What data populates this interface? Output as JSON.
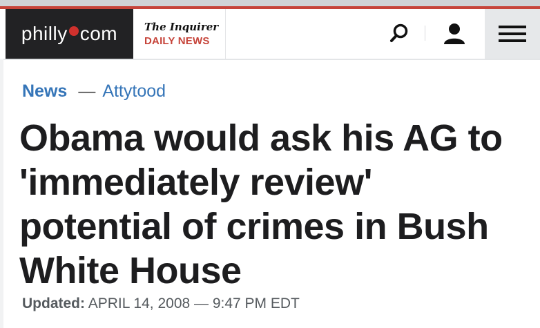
{
  "header": {
    "logo_left": "philly",
    "logo_right": "com",
    "partner_line1": "The Inquirer",
    "partner_line2": "DAILY NEWS",
    "icons": [
      "search-icon",
      "user-icon",
      "hamburger-menu-icon"
    ]
  },
  "breadcrumb": {
    "section": "News",
    "separator": "—",
    "column": "Attytood"
  },
  "article": {
    "headline": "Obama would ask his AG to 'immediately review' potential of crimes in Bush White House",
    "updated_label": "Updated:",
    "updated_value": "APRIL 14, 2008 — 9:47 PM EDT"
  },
  "colors": {
    "accent_red": "#c6443a",
    "link_blue": "#3575b8",
    "logo_bg": "#222224",
    "headline": "#1d1d1f"
  }
}
